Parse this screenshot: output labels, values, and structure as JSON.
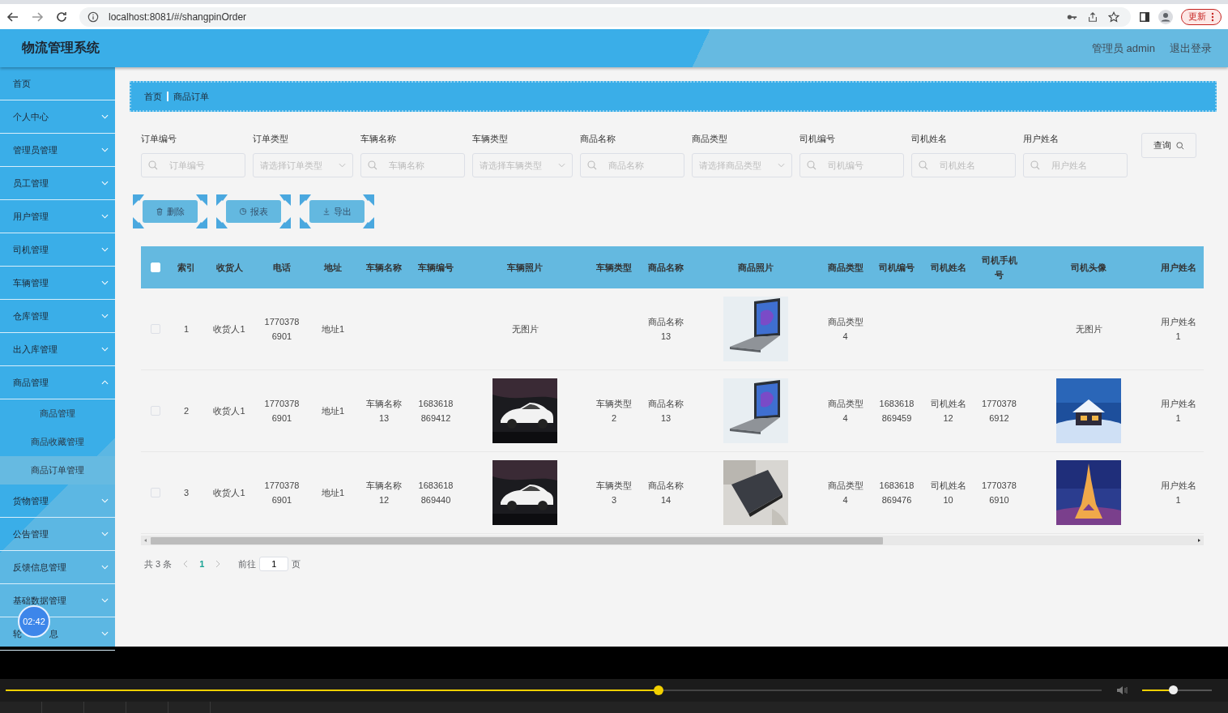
{
  "browser": {
    "url": "localhost:8081/#/shangpinOrder",
    "update_button": "更新"
  },
  "header": {
    "title": "物流管理系统",
    "user": "管理员 admin",
    "logout": "退出登录"
  },
  "sidebar": {
    "items": [
      {
        "label": "首页",
        "kind": "link"
      },
      {
        "label": "个人中心",
        "kind": "menu",
        "expanded": false
      },
      {
        "label": "管理员管理",
        "kind": "menu",
        "expanded": false
      },
      {
        "label": "员工管理",
        "kind": "menu",
        "expanded": false
      },
      {
        "label": "用户管理",
        "kind": "menu",
        "expanded": false
      },
      {
        "label": "司机管理",
        "kind": "menu",
        "expanded": false
      },
      {
        "label": "车辆管理",
        "kind": "menu",
        "expanded": false
      },
      {
        "label": "仓库管理",
        "kind": "menu",
        "expanded": false
      },
      {
        "label": "出入库管理",
        "kind": "menu",
        "expanded": false
      },
      {
        "label": "商品管理",
        "kind": "menu",
        "expanded": true,
        "children": [
          {
            "label": "商品管理",
            "selected": false
          },
          {
            "label": "商品收藏管理",
            "selected": false
          },
          {
            "label": "商品订单管理",
            "selected": true
          }
        ]
      },
      {
        "label": "货物管理",
        "kind": "menu",
        "expanded": false
      },
      {
        "label": "公告管理",
        "kind": "menu",
        "expanded": false
      },
      {
        "label": "反馈信息管理",
        "kind": "menu",
        "expanded": false
      },
      {
        "label": "基础数据管理",
        "kind": "menu",
        "expanded": false
      },
      {
        "label": "轮",
        "label_tail": "息",
        "kind": "menu",
        "expanded": false
      }
    ]
  },
  "timer": "02:42",
  "breadcrumb": [
    "首页",
    "商品订单"
  ],
  "filters": [
    {
      "label": "订单编号",
      "kind": "input",
      "placeholder": "订单编号"
    },
    {
      "label": "订单类型",
      "kind": "select",
      "placeholder": "请选择订单类型"
    },
    {
      "label": "车辆名称",
      "kind": "input",
      "placeholder": "车辆名称"
    },
    {
      "label": "车辆类型",
      "kind": "select",
      "placeholder": "请选择车辆类型"
    },
    {
      "label": "商品名称",
      "kind": "input",
      "placeholder": "商品名称"
    },
    {
      "label": "商品类型",
      "kind": "select",
      "placeholder": "请选择商品类型"
    },
    {
      "label": "司机编号",
      "kind": "input",
      "placeholder": "司机编号"
    },
    {
      "label": "司机姓名",
      "kind": "input",
      "placeholder": "司机姓名"
    },
    {
      "label": "用户姓名",
      "kind": "input",
      "placeholder": "用户姓名"
    }
  ],
  "search_button": "查询",
  "actions": [
    {
      "label": "删除",
      "kind": "delete"
    },
    {
      "label": "报表",
      "kind": "report"
    },
    {
      "label": "导出",
      "kind": "export"
    }
  ],
  "table": {
    "select_all": false,
    "columns": [
      "索引",
      "收货人",
      "电话",
      "地址",
      "车辆名称",
      "车辆编号",
      "车辆照片",
      "车辆类型",
      "商品名称",
      "商品照片",
      "商品类型",
      "司机编号",
      "司机姓名",
      "司机手机号",
      "司机头像",
      "用户姓名"
    ],
    "rows": [
      {
        "selected": false,
        "cells": [
          "1",
          "收货人1",
          "17703786901",
          "地址1",
          null,
          null,
          "无图片",
          null,
          "商品名称13",
          {
            "kind": "picture"
          },
          "商品类型4",
          null,
          null,
          null,
          "无图片",
          "用户姓名1"
        ]
      },
      {
        "selected": false,
        "cells": [
          "2",
          "收货人1",
          "17703786901",
          "地址1",
          "车辆名称13",
          "1683618869412",
          {
            "kind": "picture"
          },
          "车辆类型2",
          "商品名称13",
          {
            "kind": "picture"
          },
          "商品类型4",
          "1683618869459",
          "司机姓名12",
          "17703786912",
          {
            "kind": "picture"
          },
          "用户姓名1"
        ]
      },
      {
        "selected": false,
        "cells": [
          "3",
          "收货人1",
          "17703786901",
          "地址1",
          "车辆名称12",
          "1683618869440",
          {
            "kind": "picture"
          },
          "车辆类型3",
          "商品名称14",
          {
            "kind": "picture"
          },
          "商品类型4",
          "1683618869476",
          "司机姓名10",
          "17703786910",
          {
            "kind": "picture"
          },
          "用户姓名1"
        ]
      }
    ]
  },
  "pagination": {
    "total": "共 3 条",
    "pages": [
      {
        "label": "1",
        "selected": true
      }
    ],
    "goto_label": "前往",
    "goto_value": "1",
    "page_suffix": "页"
  },
  "player": {
    "progress": {
      "level": 0.596
    },
    "volume": {
      "level": 0.45
    }
  }
}
